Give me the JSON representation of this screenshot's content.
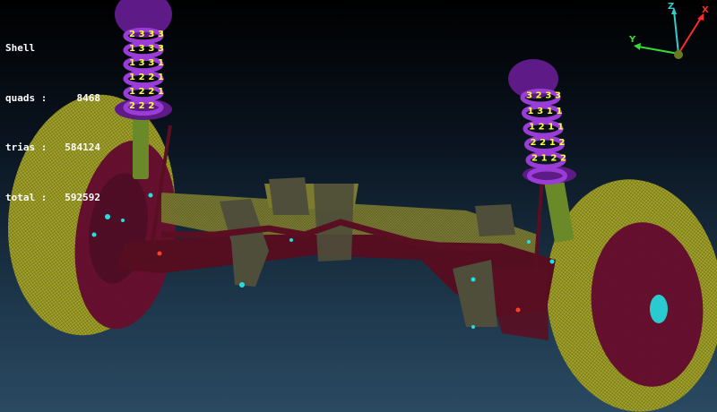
{
  "stats": {
    "title": "Shell",
    "rows": [
      {
        "label": "quads :",
        "value": "8468"
      },
      {
        "label": "trias :",
        "value": "584124"
      },
      {
        "label": "total :",
        "value": "592592"
      }
    ]
  },
  "triad": {
    "x_label": "X",
    "y_label": "Y",
    "z_label": "Z",
    "x_color": "#ff2a2a",
    "y_color": "#33dd33",
    "z_color": "#33cccc"
  },
  "colors": {
    "tire": "#a6a62a",
    "rim": "#6a1030",
    "axle": "#7a7a30",
    "arm": "#5a0e22",
    "bracket": "#4e4e3a",
    "spring": "#9a3cd6",
    "mount": "#5e1a86",
    "damper": "#6a8a2a",
    "mesh_id": "#ffff33",
    "highlight": "#22e0e0"
  },
  "left_spring_tags": [
    "2",
    "3",
    "3",
    "3",
    "1",
    "3",
    "3",
    "3",
    "1",
    "3",
    "3",
    "1",
    "1",
    "2",
    "2",
    "1",
    "1",
    "2",
    "2",
    "1",
    "2",
    "2",
    "2"
  ],
  "right_spring_tags": [
    "3",
    "2",
    "3",
    "3",
    "1",
    "3",
    "1",
    "1",
    "1",
    "2",
    "1",
    "1",
    "2",
    "2",
    "1",
    "2",
    "2",
    "1",
    "2",
    "2"
  ]
}
